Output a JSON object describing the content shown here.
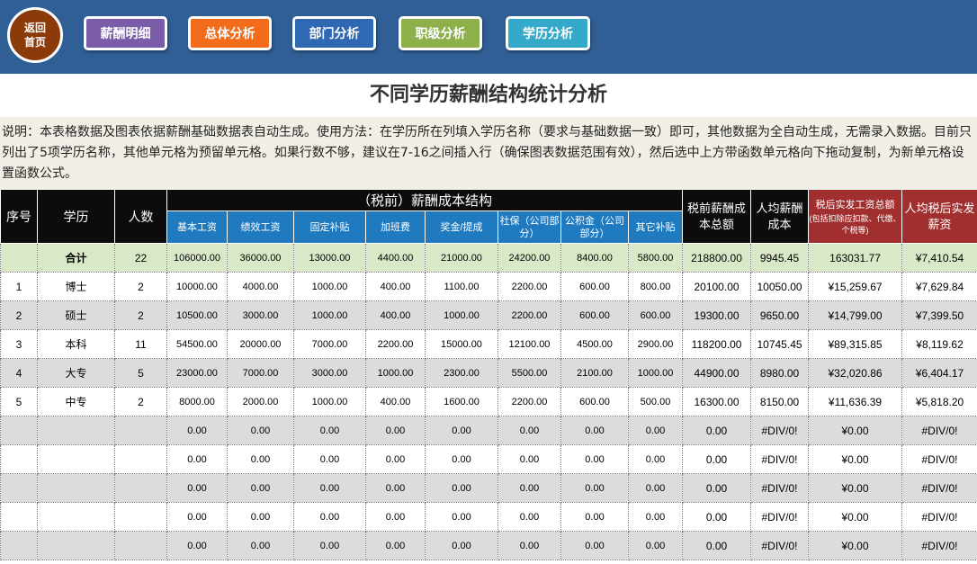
{
  "nav": {
    "home": "返回首页",
    "buttons": [
      {
        "label": "薪酬明细",
        "color": "#7b5ca8"
      },
      {
        "label": "总体分析",
        "color": "#f26c1c"
      },
      {
        "label": "部门分析",
        "color": "#2f68b3"
      },
      {
        "label": "职级分析",
        "color": "#8db04a"
      },
      {
        "label": "学历分析",
        "color": "#35a9c9"
      }
    ]
  },
  "title": "不同学历薪酬结构统计分析",
  "description": "说明：本表格数据及图表依据薪酬基础数据表自动生成。使用方法：在学历所在列填入学历名称（要求与基础数据一致）即可，其他数据为全自动生成，无需录入数据。目前只列出了5项学历名称，其他单元格为预留单元格。如果行数不够，建议在7-16之间插入行（确保图表数据范围有效），然后选中上方带函数单元格向下拖动复制，为新单元格设置函数公式。",
  "table": {
    "headers": {
      "index": "序号",
      "education": "学历",
      "count": "人数",
      "structure": "（税前）薪酬成本结构",
      "sub": [
        "基本工资",
        "绩效工资",
        "固定补贴",
        "加班费",
        "奖金/提成",
        "社保（公司部分）",
        "公积金（公司部分）",
        "其它补贴"
      ],
      "pretax_total": "税前薪酬成本总额",
      "avg_cost": "人均薪酬成本",
      "aftertax_total": "税后实发工资总额",
      "aftertax_note": "(包括扣除应扣款、代缴、个税等)",
      "avg_aftertax": "人均税后实发薪资"
    },
    "total": {
      "label": "合计",
      "count": "22",
      "values": [
        "106000.00",
        "36000.00",
        "13000.00",
        "4400.00",
        "21000.00",
        "24200.00",
        "8400.00",
        "5800.00",
        "218800.00",
        "9945.45",
        "163031.77",
        "¥7,410.54"
      ]
    },
    "rows": [
      {
        "index": "1",
        "education": "博士",
        "count": "2",
        "values": [
          "10000.00",
          "4000.00",
          "1000.00",
          "400.00",
          "1100.00",
          "2200.00",
          "600.00",
          "800.00",
          "20100.00",
          "10050.00",
          "¥15,259.67",
          "¥7,629.84"
        ]
      },
      {
        "index": "2",
        "education": "硕士",
        "count": "2",
        "values": [
          "10500.00",
          "3000.00",
          "1000.00",
          "400.00",
          "1000.00",
          "2200.00",
          "600.00",
          "600.00",
          "19300.00",
          "9650.00",
          "¥14,799.00",
          "¥7,399.50"
        ]
      },
      {
        "index": "3",
        "education": "本科",
        "count": "11",
        "values": [
          "54500.00",
          "20000.00",
          "7000.00",
          "2200.00",
          "15000.00",
          "12100.00",
          "4500.00",
          "2900.00",
          "118200.00",
          "10745.45",
          "¥89,315.85",
          "¥8,119.62"
        ]
      },
      {
        "index": "4",
        "education": "大专",
        "count": "5",
        "values": [
          "23000.00",
          "7000.00",
          "3000.00",
          "1000.00",
          "2300.00",
          "5500.00",
          "2100.00",
          "1000.00",
          "44900.00",
          "8980.00",
          "¥32,020.86",
          "¥6,404.17"
        ]
      },
      {
        "index": "5",
        "education": "中专",
        "count": "2",
        "values": [
          "8000.00",
          "2000.00",
          "1000.00",
          "400.00",
          "1600.00",
          "2200.00",
          "600.00",
          "500.00",
          "16300.00",
          "8150.00",
          "¥11,636.39",
          "¥5,818.20"
        ]
      },
      {
        "index": "",
        "education": "",
        "count": "",
        "values": [
          "0.00",
          "0.00",
          "0.00",
          "0.00",
          "0.00",
          "0.00",
          "0.00",
          "0.00",
          "0.00",
          "#DIV/0!",
          "¥0.00",
          "#DIV/0!"
        ]
      },
      {
        "index": "",
        "education": "",
        "count": "",
        "values": [
          "0.00",
          "0.00",
          "0.00",
          "0.00",
          "0.00",
          "0.00",
          "0.00",
          "0.00",
          "0.00",
          "#DIV/0!",
          "¥0.00",
          "#DIV/0!"
        ]
      },
      {
        "index": "",
        "education": "",
        "count": "",
        "values": [
          "0.00",
          "0.00",
          "0.00",
          "0.00",
          "0.00",
          "0.00",
          "0.00",
          "0.00",
          "0.00",
          "#DIV/0!",
          "¥0.00",
          "#DIV/0!"
        ]
      },
      {
        "index": "",
        "education": "",
        "count": "",
        "values": [
          "0.00",
          "0.00",
          "0.00",
          "0.00",
          "0.00",
          "0.00",
          "0.00",
          "0.00",
          "0.00",
          "#DIV/0!",
          "¥0.00",
          "#DIV/0!"
        ]
      },
      {
        "index": "",
        "education": "",
        "count": "",
        "values": [
          "0.00",
          "0.00",
          "0.00",
          "0.00",
          "0.00",
          "0.00",
          "0.00",
          "0.00",
          "0.00",
          "#DIV/0!",
          "¥0.00",
          "#DIV/0!"
        ]
      }
    ]
  }
}
